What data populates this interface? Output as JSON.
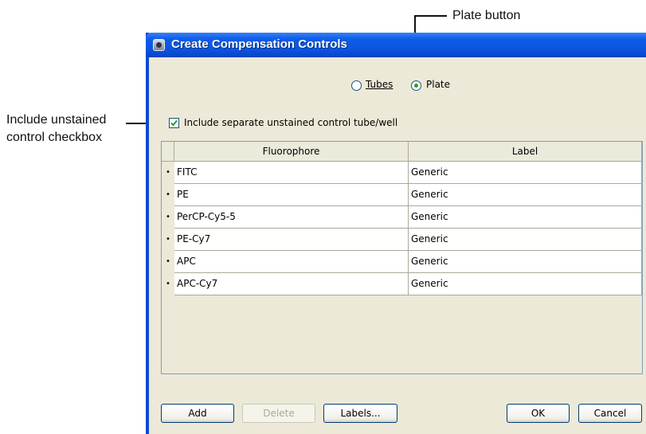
{
  "callouts": {
    "plate_button": "Plate button",
    "include_unstained_line1": "Include unstained",
    "include_unstained_line2": "control checkbox"
  },
  "dialog": {
    "title": "Create Compensation Controls",
    "radio_options": [
      {
        "label": "Tubes",
        "selected": false
      },
      {
        "label": "Plate",
        "selected": true
      }
    ],
    "include_unstained": {
      "label": "Include separate unstained control tube/well",
      "checked": true
    },
    "table": {
      "columns": [
        "Fluorophore",
        "Label"
      ],
      "row_marker": "•",
      "rows": [
        {
          "fluorophore": "FITC",
          "label": "Generic"
        },
        {
          "fluorophore": "PE",
          "label": "Generic"
        },
        {
          "fluorophore": "PerCP-Cy5-5",
          "label": "Generic"
        },
        {
          "fluorophore": "PE-Cy7",
          "label": "Generic"
        },
        {
          "fluorophore": "APC",
          "label": "Generic"
        },
        {
          "fluorophore": "APC-Cy7",
          "label": "Generic"
        }
      ]
    },
    "buttons": {
      "add": "Add",
      "delete": "Delete",
      "labels": "Labels...",
      "ok": "OK",
      "cancel": "Cancel"
    }
  },
  "colors": {
    "titlebar": "#0b54de",
    "dialog_bg": "#ece9d8",
    "radio_dot": "#21a121"
  }
}
